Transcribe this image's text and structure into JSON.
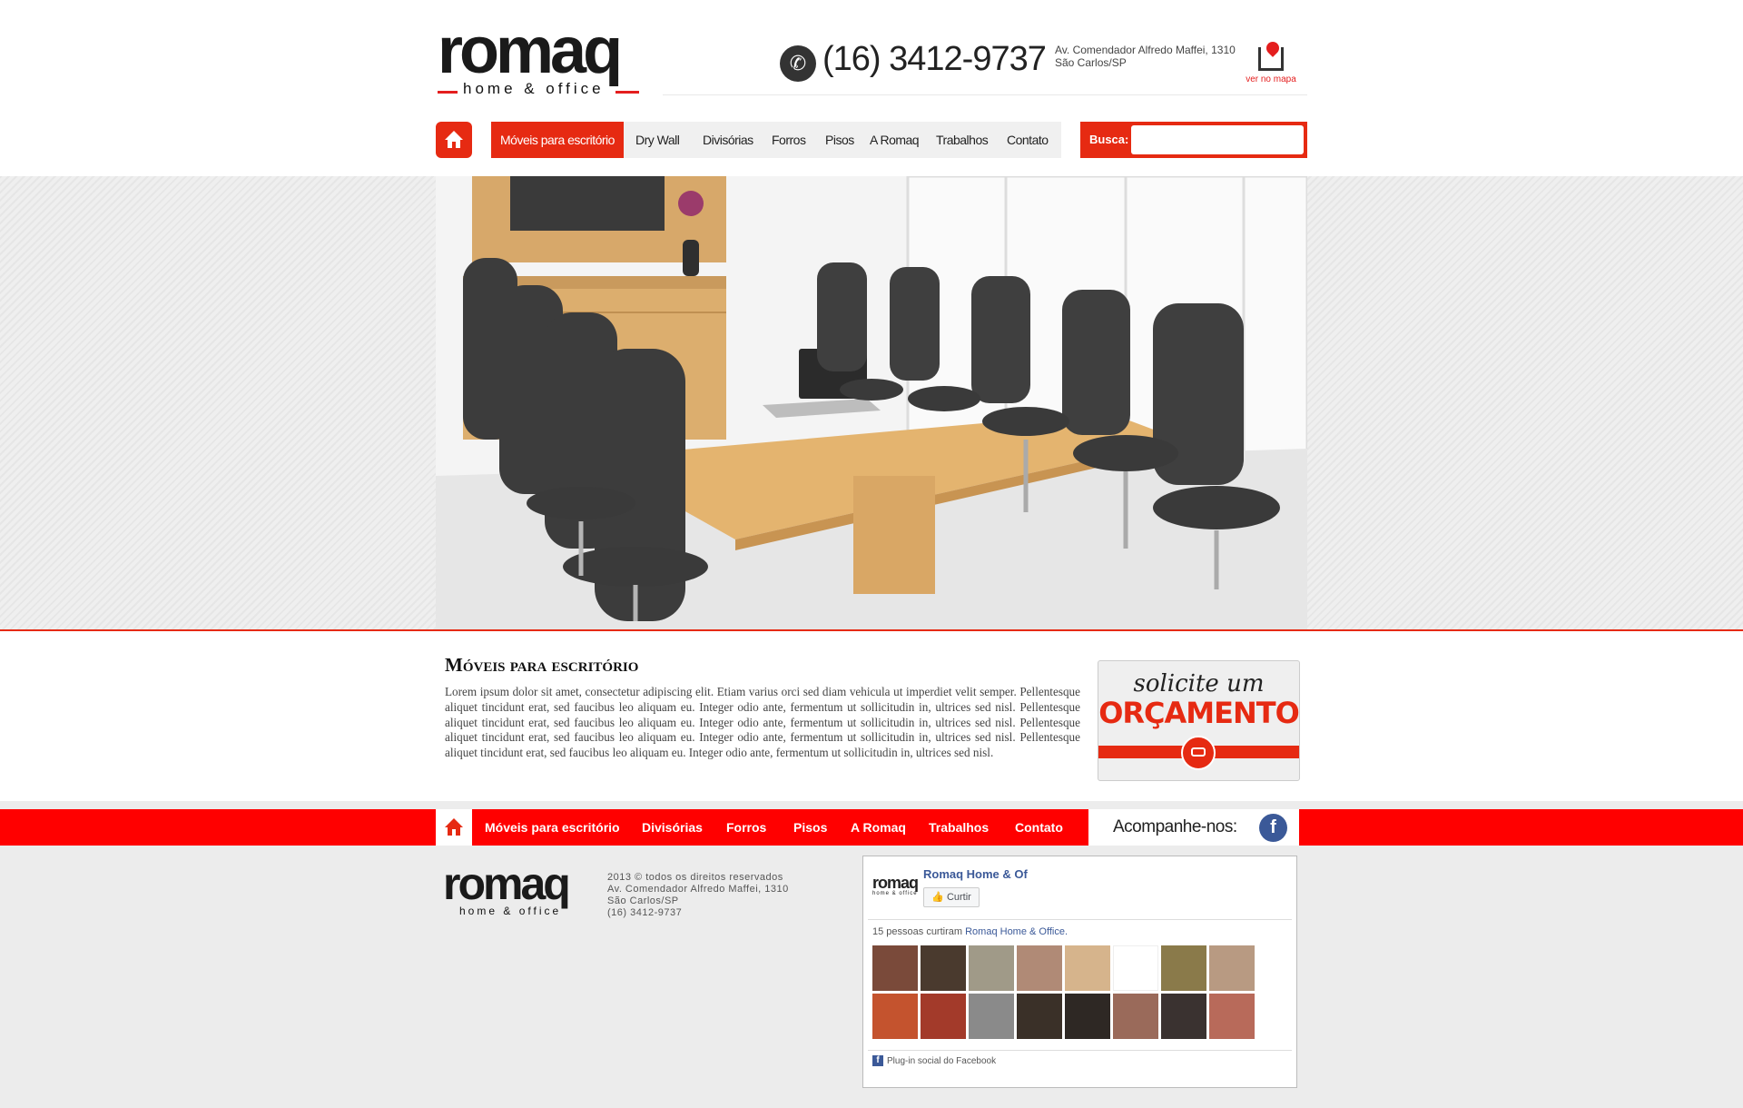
{
  "header": {
    "logo_word": "romaq",
    "logo_sub": "home & office",
    "phone": "(16) 3412-9737",
    "address_line1": "Av. Comendador Alfredo Maffei, 1310",
    "address_line2": "São Carlos/SP",
    "map_label": "ver no mapa"
  },
  "nav": {
    "items": [
      "Móveis para escritório",
      "Dry Wall",
      "Divisórias",
      "Forros",
      "Pisos",
      "A Romaq",
      "Trabalhos",
      "Contato"
    ],
    "active_index": 0,
    "search_label": "Busca:",
    "search_value": ""
  },
  "content": {
    "title": "Móveis para escritório",
    "body": "Lorem ipsum dolor sit amet, consectetur adipiscing elit. Etiam varius orci sed diam vehicula ut imperdiet velit semper. Pellentesque aliquet tincidunt erat, sed faucibus leo aliquam eu. Integer odio ante, fermentum ut sollicitudin in, ultrices sed nisl. Pellentesque aliquet tincidunt erat, sed faucibus leo aliquam eu. Integer odio ante, fermentum ut sollicitudin in, ultrices sed nisl. Pellentesque aliquet tincidunt erat, sed faucibus leo aliquam eu. Integer odio ante, fermentum ut sollicitudin in, ultrices sed nisl. Pellentesque aliquet tincidunt erat, sed faucibus leo aliquam eu. Integer odio ante, fermentum ut sollicitudin in, ultrices sed nisl."
  },
  "quote": {
    "small": "solicite um",
    "big": "ORÇAMENTO"
  },
  "footer_nav": {
    "items": [
      "Móveis para escritório",
      "Divisórias",
      "Forros",
      "Pisos",
      "A Romaq",
      "Trabalhos",
      "Contato"
    ],
    "follow_label": "Acompanhe-nos:"
  },
  "footer": {
    "logo_word": "romaq",
    "logo_sub": "home & office",
    "copyright": "2013 © todos os direitos reservados",
    "address_line1": "Av. Comendador Alfredo Maffei, 1310",
    "address_line2": "São Carlos/SP",
    "phone": "(16) 3412-9737"
  },
  "facebook": {
    "page_name": "Romaq Home & Of",
    "like_label": "Curtir",
    "count_prefix": "15 pessoas curtiram",
    "count_page": "Romaq Home & Office.",
    "plugin_label": "Plug-in social do Facebook",
    "page_logo_word": "romaq",
    "page_logo_sub": "home & office"
  },
  "colors": {
    "brand_red": "#e62a12",
    "footer_red": "#ff0000",
    "facebook_blue": "#3b5998"
  }
}
